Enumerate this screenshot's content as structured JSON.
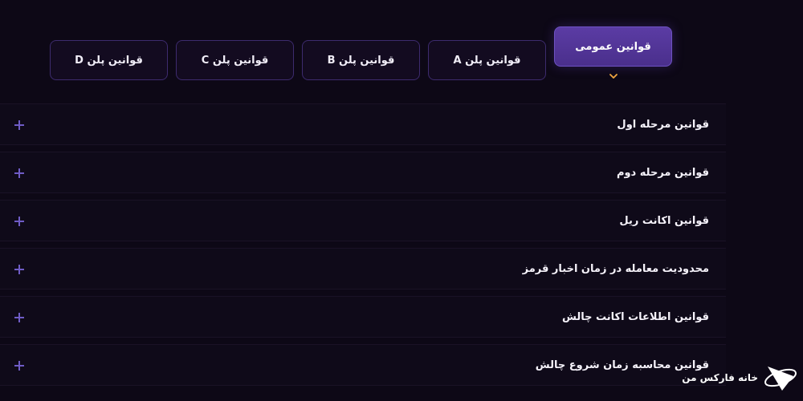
{
  "tabs": [
    {
      "label": "قوانین عمومی",
      "active": true
    },
    {
      "label": "قوانین پلن A",
      "active": false
    },
    {
      "label": "قوانین پلن B",
      "active": false
    },
    {
      "label": "قوانین پلن C",
      "active": false
    },
    {
      "label": "قوانین پلن D",
      "active": false
    }
  ],
  "accordion": {
    "items": [
      {
        "title": "قوانین مرحله اول",
        "icon": "plus-icon"
      },
      {
        "title": "قوانین مرحله دوم",
        "icon": "plus-icon"
      },
      {
        "title": "قوانین اکانت ریل",
        "icon": "plus-icon"
      },
      {
        "title": "محدودیت معامله در زمان اخبار قرمز",
        "icon": "plus-icon"
      },
      {
        "title": "قوانین اطلاعات اکانت چالش",
        "icon": "plus-icon"
      },
      {
        "title": "قوانین محاسبه زمان شروع چالش",
        "icon": "plus-icon"
      }
    ]
  },
  "brand": {
    "name": "خانه فارکس من",
    "icon": "house-logo-icon"
  },
  "colors": {
    "background": "#0d0816",
    "tab_active": "#5b3ca4",
    "tab_border": "#3d2b6e",
    "plus_icon": "#6f5cc6",
    "caret": "#f0a640"
  }
}
